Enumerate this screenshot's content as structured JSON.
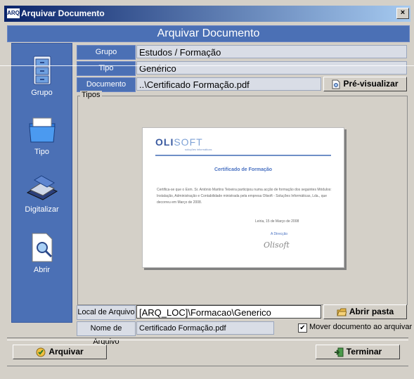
{
  "window": {
    "title": "Arquivar Documento",
    "app_icon": "ARQ",
    "close_label": "×"
  },
  "header": {
    "title": "Arquivar Documento"
  },
  "sidebar": {
    "items": [
      {
        "label": "Grupo",
        "icon": "cabinet-icon"
      },
      {
        "label": "Tipo",
        "icon": "folder-icon"
      },
      {
        "label": "Digitalizar",
        "icon": "scanner-icon"
      },
      {
        "label": "Abrir",
        "icon": "open-document-icon"
      }
    ]
  },
  "form": {
    "grupo_label": "Grupo",
    "grupo_value": "Estudos / Formação",
    "tipo_label": "Tipo",
    "tipo_value": "Genérico",
    "documento_label": "Documento",
    "documento_value": "..\\Certificado Formação.pdf",
    "preview_button": "Pré-visualizar",
    "tipos_group": "Tipos",
    "local_label": "Local de Arquivo",
    "local_value": "[ARQ_LOC]\\Formacao\\Generico",
    "abrir_pasta_button": "Abrir pasta",
    "nome_label": "Nome de Arquivo",
    "nome_value": "Certificado Formação.pdf",
    "mover_label": "Mover documento ao arquivar",
    "mover_checked": "✔"
  },
  "preview": {
    "logo_main": "OLI",
    "logo_accent": "SOFT",
    "logo_sub": "soluções informáticas",
    "title": "Certificado de Formação",
    "body": "Certifica-se que o Exm. Sr. António Martins Teixeira participou numa acção de formação dos seguintes Módulos: Instalação, Administração e Contabilidade ministrada pela empresa Olisoft - Soluções Informáticas, Lda., que decorreu em Março de 2008.",
    "date": "Leiria, 15 de Março de 2008",
    "signer": "A Direcção",
    "signature": "Olisoft"
  },
  "footer": {
    "arquivar_button": "Arquivar",
    "terminar_button": "Terminar"
  }
}
